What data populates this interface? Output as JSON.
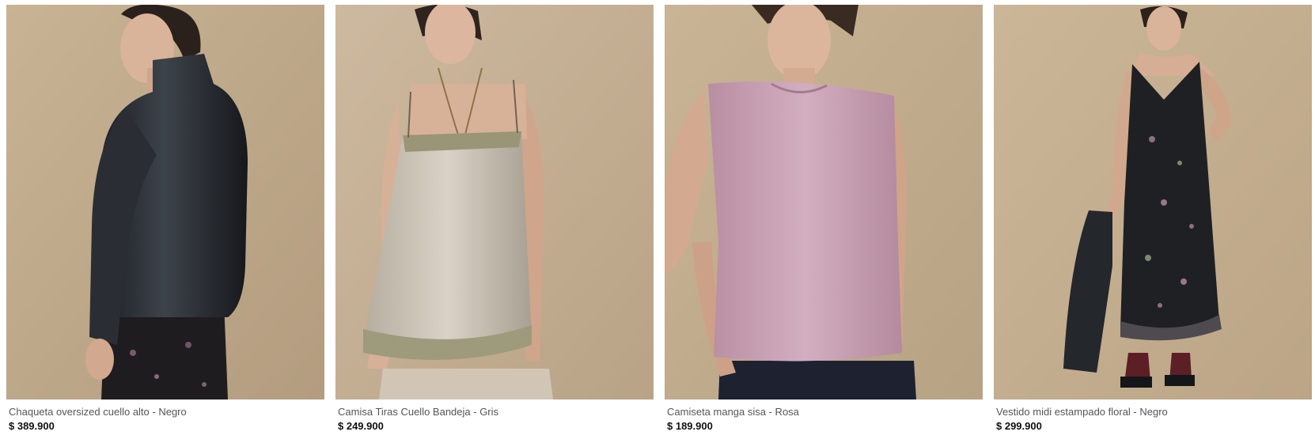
{
  "products": [
    {
      "name": "Chaqueta oversized cuello alto - Negro",
      "price": "$ 389.900",
      "image_icon": "model-black-leather-jacket-image",
      "background_color": "#c1ab8d",
      "garment_color": "#24282d"
    },
    {
      "name": "Camisa Tiras Cuello Bandeja - Gris",
      "price": "$ 249.900",
      "image_icon": "model-grey-satin-camisole-image",
      "background_color": "#c6b197",
      "garment_color": "#c8c0b2"
    },
    {
      "name": "Camiseta manga sisa - Rosa",
      "price": "$ 189.900",
      "image_icon": "model-pink-sleeveless-top-image",
      "background_color": "#c3ad8f",
      "garment_color": "#c8a1b4"
    },
    {
      "name": "Vestido midi estampado floral - Negro",
      "price": "$ 299.900",
      "image_icon": "model-black-floral-midi-dress-image",
      "background_color": "#c6b192",
      "garment_color": "#1e1f22"
    }
  ]
}
